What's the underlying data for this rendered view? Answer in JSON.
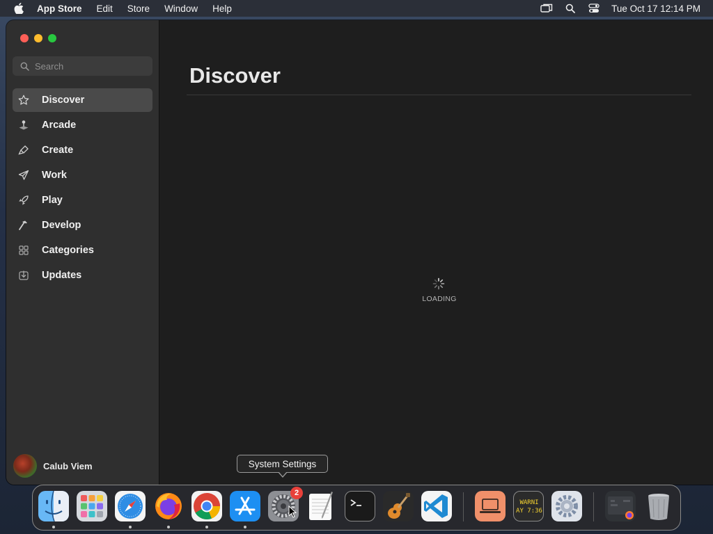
{
  "menubar": {
    "app_name": "App Store",
    "menus": [
      "Edit",
      "Store",
      "Window",
      "Help"
    ],
    "clock": "Tue Oct 17  12:14 PM",
    "status_icons": [
      "screen-mirroring-icon",
      "spotlight-search-icon",
      "control-center-icon"
    ]
  },
  "sidebar": {
    "search": {
      "placeholder": "Search",
      "value": ""
    },
    "items": [
      {
        "label": "Discover",
        "icon": "star-icon",
        "active": true
      },
      {
        "label": "Arcade",
        "icon": "joystick-icon",
        "active": false
      },
      {
        "label": "Create",
        "icon": "brush-icon",
        "active": false
      },
      {
        "label": "Work",
        "icon": "paper-plane-icon",
        "active": false
      },
      {
        "label": "Play",
        "icon": "rocket-icon",
        "active": false
      },
      {
        "label": "Develop",
        "icon": "hammer-icon",
        "active": false
      },
      {
        "label": "Categories",
        "icon": "grid-icon",
        "active": false
      },
      {
        "label": "Updates",
        "icon": "download-icon",
        "active": false
      }
    ],
    "account": {
      "name": "Calub Viem"
    }
  },
  "main": {
    "title": "Discover",
    "loading_text": "LOADING"
  },
  "tooltip": {
    "text": "System Settings"
  },
  "dock": {
    "apps": [
      {
        "name": "Finder",
        "icon": "finder-icon",
        "running": true
      },
      {
        "name": "Launchpad",
        "icon": "launchpad-icon",
        "running": false
      },
      {
        "name": "Safari",
        "icon": "safari-icon",
        "running": true
      },
      {
        "name": "Firefox",
        "icon": "firefox-icon",
        "running": true
      },
      {
        "name": "Chrome",
        "icon": "chrome-icon",
        "running": true
      },
      {
        "name": "App Store",
        "icon": "app-store-icon",
        "running": true
      },
      {
        "name": "System Settings",
        "icon": "system-settings-icon",
        "running": false,
        "badge": "2"
      },
      {
        "name": "TextEdit",
        "icon": "textedit-icon",
        "running": false
      },
      {
        "name": "Terminal",
        "icon": "terminal-icon",
        "running": false
      },
      {
        "name": "GarageBand",
        "icon": "garageband-icon",
        "running": false
      },
      {
        "name": "Visual Studio Code",
        "icon": "vscode-icon",
        "running": false
      },
      {
        "name": "Screen Sharing",
        "icon": "screen-sharing-icon",
        "running": false
      },
      {
        "name": "Console",
        "icon": "console-icon",
        "running": false,
        "tile_text": "WARNI\nAY 7:36"
      },
      {
        "name": "Utility",
        "icon": "gear-utility-icon",
        "running": false
      },
      {
        "name": "Downloads Stack",
        "icon": "stack-icon",
        "running": false
      },
      {
        "name": "Trash",
        "icon": "trash-icon",
        "running": false
      }
    ]
  },
  "colors": {
    "sidebar_bg": "#2f2f2f",
    "main_bg": "#1e1e1e",
    "active_item_bg": "#4a4a4a",
    "close": "#fe5f57",
    "minimize": "#febc2e",
    "maximize": "#28c840",
    "badge": "#e8403a"
  }
}
